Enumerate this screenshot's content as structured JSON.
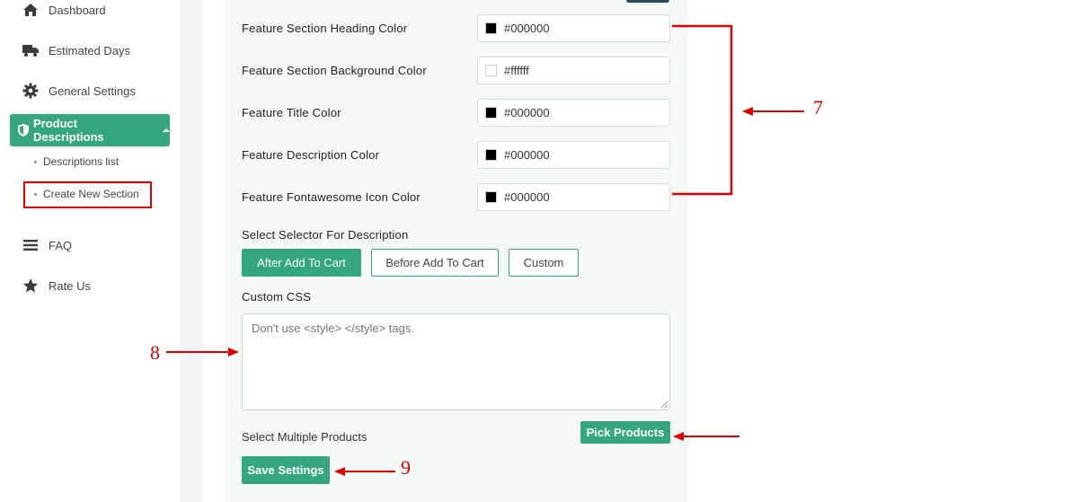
{
  "sidebar": {
    "items": [
      {
        "label": "Dashboard",
        "icon": "home-icon"
      },
      {
        "label": "Estimated Days",
        "icon": "truck-icon"
      },
      {
        "label": "General Settings",
        "icon": "gear-icon"
      },
      {
        "label": "Product Descriptions",
        "icon": "shield-icon",
        "active": true
      },
      {
        "label": "FAQ",
        "icon": "menu-icon"
      },
      {
        "label": "Rate Us",
        "icon": "star-icon"
      }
    ],
    "sub_items": [
      {
        "label": "Descriptions list"
      },
      {
        "label": "Create New Section",
        "highlighted": true
      }
    ]
  },
  "form": {
    "color_fields": [
      {
        "label": "Feature Section Heading Color",
        "value": "#000000",
        "swatch": "#000000"
      },
      {
        "label": "Feature Section Background Color",
        "value": "#ffffff",
        "swatch": "#ffffff"
      },
      {
        "label": "Feature Title Color",
        "value": "#000000",
        "swatch": "#000000"
      },
      {
        "label": "Feature Description Color",
        "value": "#000000",
        "swatch": "#000000"
      },
      {
        "label": "Feature Fontawesome Icon Color",
        "value": "#000000",
        "swatch": "#000000"
      }
    ],
    "selector_label": "Select Selector For Description",
    "selector_options": [
      {
        "label": "After Add To Cart",
        "selected": true
      },
      {
        "label": "Before Add To Cart",
        "selected": false
      },
      {
        "label": "Custom",
        "selected": false
      }
    ],
    "custom_css_label": "Custom CSS",
    "custom_css_placeholder": "Don't use <style> </style> tags.",
    "custom_css_value": "",
    "multi_products_label": "Select Multiple Products",
    "pick_products_label": "Pick Products",
    "save_label": "Save Settings"
  },
  "annotations": {
    "seven": "7",
    "eight": "8",
    "nine": "9"
  },
  "colors": {
    "accent": "#34a77f",
    "annotation": "#e00000",
    "panel_bg": "#f4f9f5"
  }
}
